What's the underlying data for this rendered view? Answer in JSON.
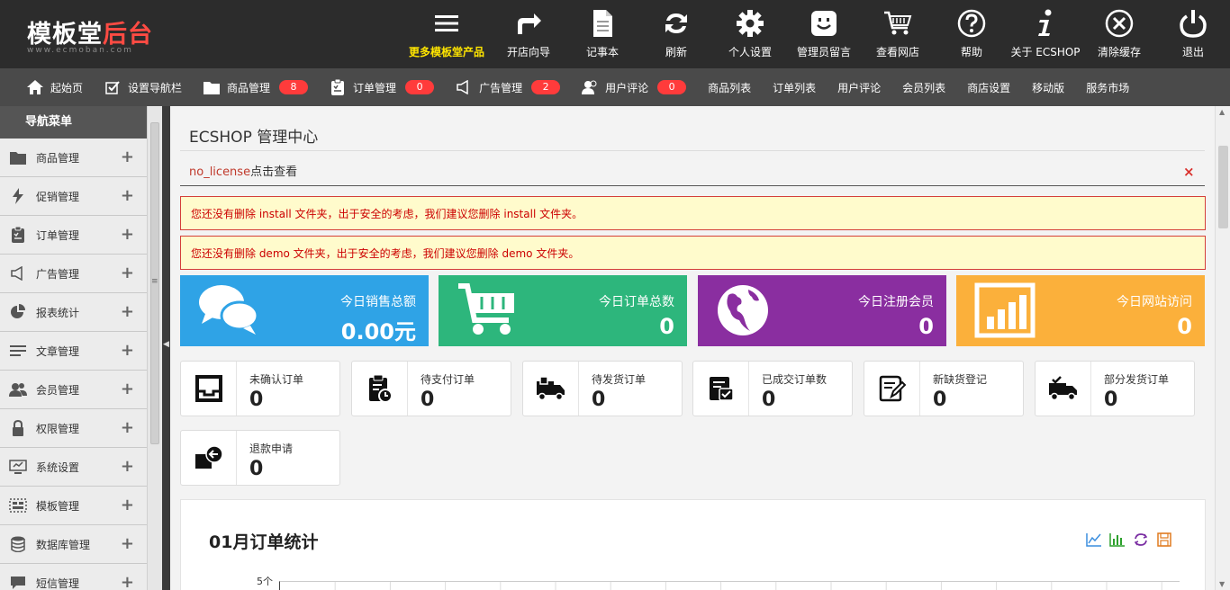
{
  "brand": {
    "main": "模板堂",
    "accent": "后台",
    "sub": "www.ecmoban.com"
  },
  "topnav": [
    {
      "id": "more",
      "label": "更多模板堂产品",
      "icon": "menu-icon",
      "highlight": true
    },
    {
      "id": "wizard",
      "label": "开店向导",
      "icon": "share-arrow-icon"
    },
    {
      "id": "notepad",
      "label": "记事本",
      "icon": "notepad-icon"
    },
    {
      "id": "refresh",
      "label": "刷新",
      "icon": "refresh-icon"
    },
    {
      "id": "settings",
      "label": "个人设置",
      "icon": "gear-icon"
    },
    {
      "id": "messages",
      "label": "管理员留言",
      "icon": "smiley-message-icon"
    },
    {
      "id": "store",
      "label": "查看网店",
      "icon": "cart-icon"
    },
    {
      "id": "help",
      "label": "帮助",
      "icon": "help-icon"
    },
    {
      "id": "about",
      "label": "关于 ECSHOP",
      "icon": "info-icon"
    },
    {
      "id": "clear",
      "label": "清除缓存",
      "icon": "close-circle-icon"
    },
    {
      "id": "logout",
      "label": "退出",
      "icon": "power-icon"
    }
  ],
  "subnav": [
    {
      "label": "起始页",
      "icon": "home-icon"
    },
    {
      "label": "设置导航栏",
      "icon": "checkbox-icon"
    },
    {
      "label": "商品管理",
      "icon": "folder-icon",
      "badge": "8"
    },
    {
      "label": "订单管理",
      "icon": "clipboard-icon",
      "badge": "0"
    },
    {
      "label": "广告管理",
      "icon": "megaphone-icon",
      "badge": "2"
    },
    {
      "label": "用户评论",
      "icon": "users-icon",
      "badge": "0"
    },
    {
      "label": "商品列表"
    },
    {
      "label": "订单列表"
    },
    {
      "label": "用户评论"
    },
    {
      "label": "会员列表"
    },
    {
      "label": "商店设置"
    },
    {
      "label": "移动版"
    },
    {
      "label": "服务市场"
    }
  ],
  "sidebar": {
    "title": "导航菜单",
    "items": [
      {
        "label": "商品管理",
        "icon": "folder-icon"
      },
      {
        "label": "促销管理",
        "icon": "lightning-icon"
      },
      {
        "label": "订单管理",
        "icon": "clipboard-icon"
      },
      {
        "label": "广告管理",
        "icon": "megaphone-icon"
      },
      {
        "label": "报表统计",
        "icon": "pie-chart-icon"
      },
      {
        "label": "文章管理",
        "icon": "list-icon"
      },
      {
        "label": "会员管理",
        "icon": "users-icon"
      },
      {
        "label": "权限管理",
        "icon": "lock-icon"
      },
      {
        "label": "系统设置",
        "icon": "monitor-icon"
      },
      {
        "label": "模板管理",
        "icon": "template-icon"
      },
      {
        "label": "数据库管理",
        "icon": "database-icon"
      },
      {
        "label": "短信管理",
        "icon": "message-icon"
      }
    ]
  },
  "main": {
    "title": "ECSHOP 管理中心",
    "license_key": "no_license",
    "license_text": "点击查看",
    "close_symbol": "×",
    "warnings": [
      "您还没有删除 install 文件夹，出于安全的考虑，我们建议您删除 install 文件夹。",
      "您还没有删除 demo 文件夹，出于安全的考虑，我们建议您删除 demo 文件夹。"
    ],
    "stats": [
      {
        "label": "今日销售总额",
        "value": "0.00元",
        "color": "#2fa3e6",
        "icon": "chat-bubbles-icon"
      },
      {
        "label": "今日订单总数",
        "value": "0",
        "color": "#2db67c",
        "icon": "cart-icon"
      },
      {
        "label": "今日注册会员",
        "value": "0",
        "color": "#8a2ea0",
        "icon": "globe-icon"
      },
      {
        "label": "今日网站访问",
        "value": "0",
        "color": "#fbb03b",
        "icon": "bar-chart-icon"
      }
    ],
    "order_cards": [
      {
        "label": "未确认订单",
        "value": "0",
        "icon": "inbox-icon"
      },
      {
        "label": "待支付订单",
        "value": "0",
        "icon": "clipboard-clock-icon"
      },
      {
        "label": "待发货订单",
        "value": "0",
        "icon": "truck-icon"
      },
      {
        "label": "已成交订单数",
        "value": "0",
        "icon": "check-document-icon"
      },
      {
        "label": "新缺货登记",
        "value": "0",
        "icon": "edit-document-icon"
      },
      {
        "label": "部分发货订单",
        "value": "0",
        "icon": "truck-check-icon"
      },
      {
        "label": "退款申请",
        "value": "0",
        "icon": "refund-icon"
      }
    ],
    "chart": {
      "title": "01月订单统计",
      "y_top_label": "5个",
      "tools": [
        "line-chart-icon",
        "bar-chart-icon",
        "restore-icon",
        "save-icon"
      ],
      "tool_colors": [
        "#3b8ede",
        "#2ca02c",
        "#7b2fa3",
        "#e07a1f"
      ]
    }
  }
}
